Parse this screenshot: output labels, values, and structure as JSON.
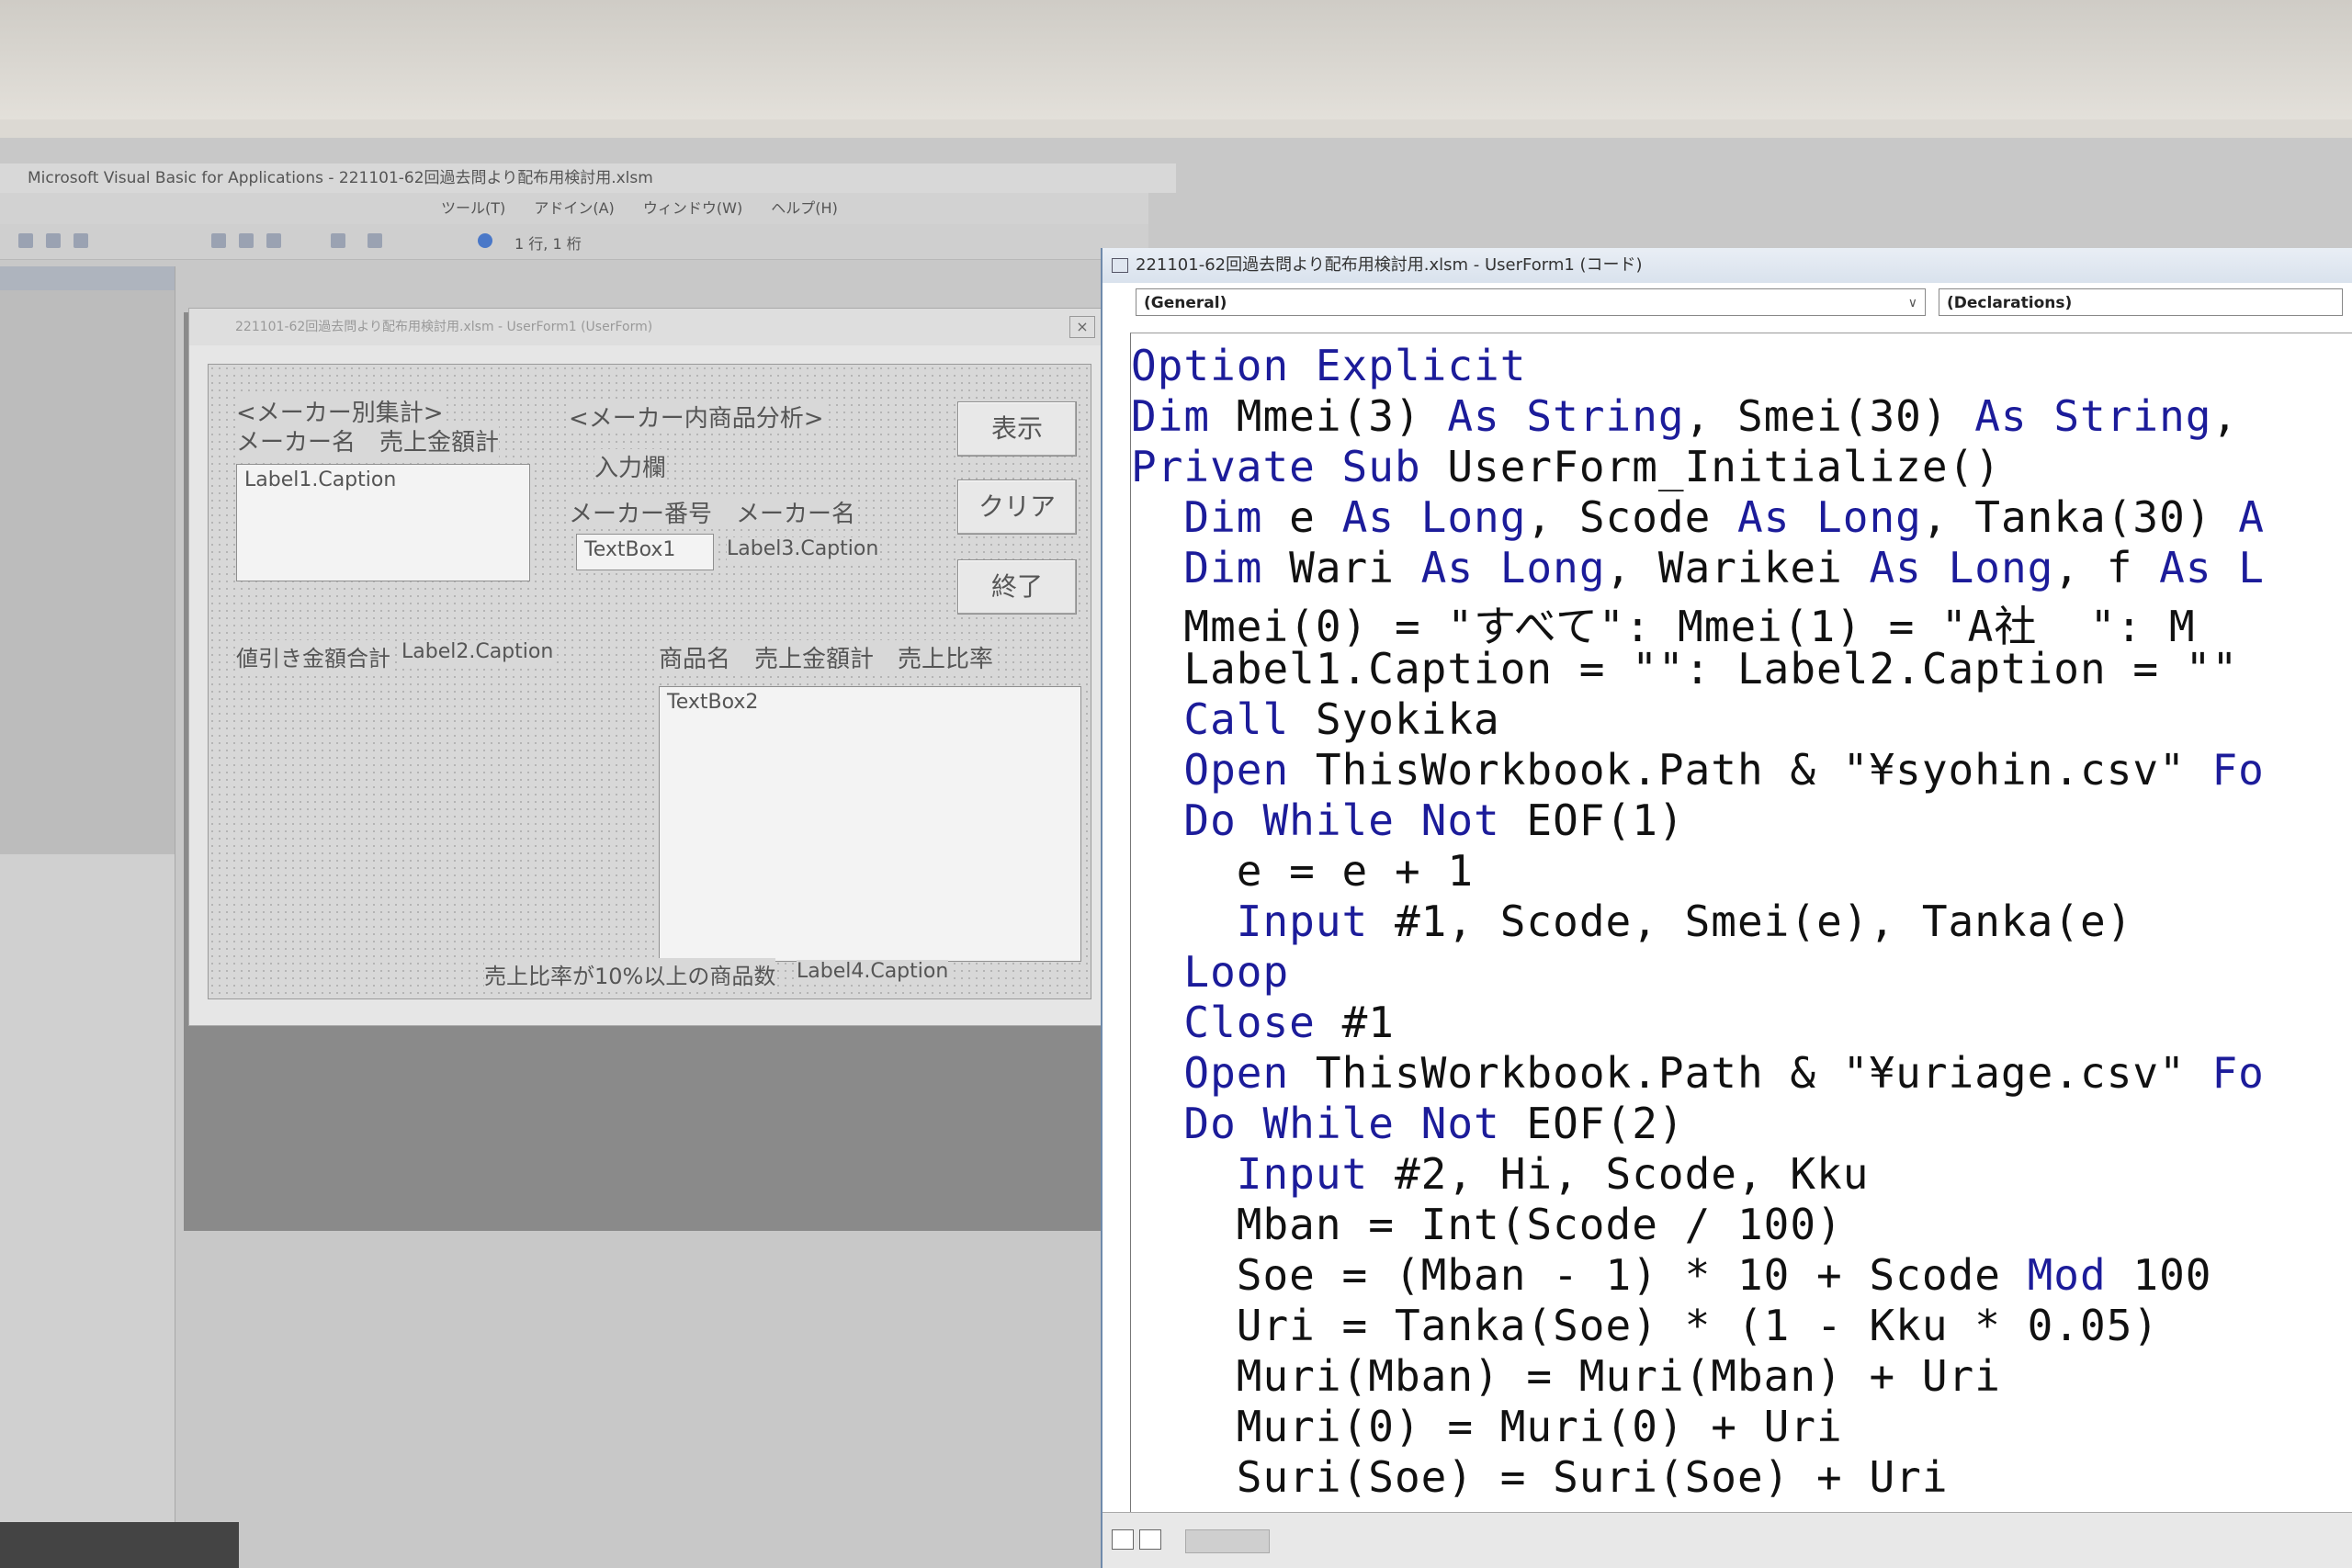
{
  "ide": {
    "title": "Microsoft Visual Basic for Applications - 221101-62回過去問より配布用検討用.xlsm",
    "menu": [
      "ツール(T)",
      "アドイン(A)",
      "ウィンドウ(W)",
      "ヘルプ(H)"
    ],
    "cursor_pos": "1 行, 1 桁"
  },
  "form_window": {
    "title": "221101-62回過去問より配布用検討用.xlsm - UserForm1 (UserForm)",
    "close_label": "×"
  },
  "form": {
    "label_maker_total": "<メーカー別集計>",
    "label_maker_cols": "メーカー名　売上金額計",
    "label1": "Label1.Caption",
    "label_product_analysis": "<メーカー内商品分析>",
    "label_input": "入力欄",
    "label_maker_no_name": "メーカー番号　メーカー名",
    "textbox1": "TextBox1",
    "label3": "Label3.Caption",
    "btn_show": "表示",
    "btn_clear": "クリア",
    "btn_exit": "終了",
    "label_discount_total": "値引き金額合計",
    "label2": "Label2.Caption",
    "label_product_cols": "商品名　売上金額計　売上比率",
    "textbox2": "TextBox2",
    "label_ratio_count": "売上比率が10%以上の商品数",
    "label4": "Label4.Caption"
  },
  "code_window": {
    "title": "221101-62回過去問より配布用検討用.xlsm - UserForm1 (コード)",
    "object_combo": "(General)",
    "proc_combo": "(Declarations)"
  },
  "code_lines": [
    [
      {
        "k": 1,
        "t": "Option Explicit"
      }
    ],
    [
      {
        "k": 1,
        "t": "Dim "
      },
      {
        "k": 0,
        "t": "Mmei(3) "
      },
      {
        "k": 1,
        "t": "As String"
      },
      {
        "k": 0,
        "t": ", Smei(30) "
      },
      {
        "k": 1,
        "t": "As String"
      },
      {
        "k": 0,
        "t": ","
      }
    ],
    [
      {
        "k": 1,
        "t": "Private Sub "
      },
      {
        "k": 0,
        "t": "UserForm_Initialize()"
      }
    ],
    [
      {
        "k": 1,
        "t": "  Dim "
      },
      {
        "k": 0,
        "t": "e "
      },
      {
        "k": 1,
        "t": "As Long"
      },
      {
        "k": 0,
        "t": ", Scode "
      },
      {
        "k": 1,
        "t": "As Long"
      },
      {
        "k": 0,
        "t": ", Tanka(30) "
      },
      {
        "k": 1,
        "t": "A"
      }
    ],
    [
      {
        "k": 1,
        "t": "  Dim "
      },
      {
        "k": 0,
        "t": "Wari "
      },
      {
        "k": 1,
        "t": "As Long"
      },
      {
        "k": 0,
        "t": ", Warikei "
      },
      {
        "k": 1,
        "t": "As Long"
      },
      {
        "k": 0,
        "t": ", f "
      },
      {
        "k": 1,
        "t": "As L"
      }
    ],
    [
      {
        "k": 0,
        "t": "  Mmei(0) = \"すべて\": Mmei(1) = \"A社  \": M"
      }
    ],
    [
      {
        "k": 0,
        "t": "  Label1.Caption = \"\": Label2.Caption = \"\""
      }
    ],
    [
      {
        "k": 1,
        "t": "  Call "
      },
      {
        "k": 0,
        "t": "Syokika"
      }
    ],
    [
      {
        "k": 1,
        "t": "  Open "
      },
      {
        "k": 0,
        "t": "ThisWorkbook.Path & \"¥syohin.csv\" "
      },
      {
        "k": 1,
        "t": "Fo"
      }
    ],
    [
      {
        "k": 1,
        "t": "  Do While Not "
      },
      {
        "k": 0,
        "t": "EOF(1)"
      }
    ],
    [
      {
        "k": 0,
        "t": "    e = e + 1"
      }
    ],
    [
      {
        "k": 1,
        "t": "    Input "
      },
      {
        "k": 0,
        "t": "#1, Scode, Smei(e), Tanka(e)"
      }
    ],
    [
      {
        "k": 1,
        "t": "  Loop"
      }
    ],
    [
      {
        "k": 1,
        "t": "  Close "
      },
      {
        "k": 0,
        "t": "#1"
      }
    ],
    [
      {
        "k": 1,
        "t": "  Open "
      },
      {
        "k": 0,
        "t": "ThisWorkbook.Path & \"¥uriage.csv\" "
      },
      {
        "k": 1,
        "t": "Fo"
      }
    ],
    [
      {
        "k": 1,
        "t": "  Do While Not "
      },
      {
        "k": 0,
        "t": "EOF(2)"
      }
    ],
    [
      {
        "k": 1,
        "t": "    Input "
      },
      {
        "k": 0,
        "t": "#2, Hi, Scode, Kku"
      }
    ],
    [
      {
        "k": 0,
        "t": "    Mban = Int(Scode / 100)"
      }
    ],
    [
      {
        "k": 0,
        "t": "    Soe = (Mban - 1) * 10 + Scode "
      },
      {
        "k": 1,
        "t": "Mod "
      },
      {
        "k": 0,
        "t": "100"
      }
    ],
    [
      {
        "k": 0,
        "t": "    Uri = Tanka(Soe) * (1 - Kku * 0.05)"
      }
    ],
    [
      {
        "k": 0,
        "t": "    Muri(Mban) = Muri(Mban) + Uri"
      }
    ],
    [
      {
        "k": 0,
        "t": "    Muri(0) = Muri(0) + Uri"
      }
    ],
    [
      {
        "k": 0,
        "t": "    Suri(Soe) = Suri(Soe) + Uri"
      }
    ]
  ],
  "colors": {
    "keyword": "#1c1c9a",
    "text": "#111111"
  }
}
